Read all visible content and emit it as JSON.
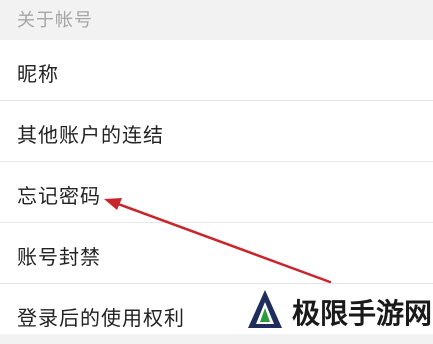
{
  "section": {
    "title": "关于帐号"
  },
  "items": [
    {
      "label": "昵称"
    },
    {
      "label": "其他账户的连结"
    },
    {
      "label": "忘记密码"
    },
    {
      "label": "账号封禁"
    },
    {
      "label": "登录后的使用权利"
    }
  ],
  "annotation": {
    "color": "#c8262b"
  },
  "watermark": {
    "text": "极限手游网",
    "accent": "#2e9b3a",
    "dark": "#1f2d5c"
  }
}
